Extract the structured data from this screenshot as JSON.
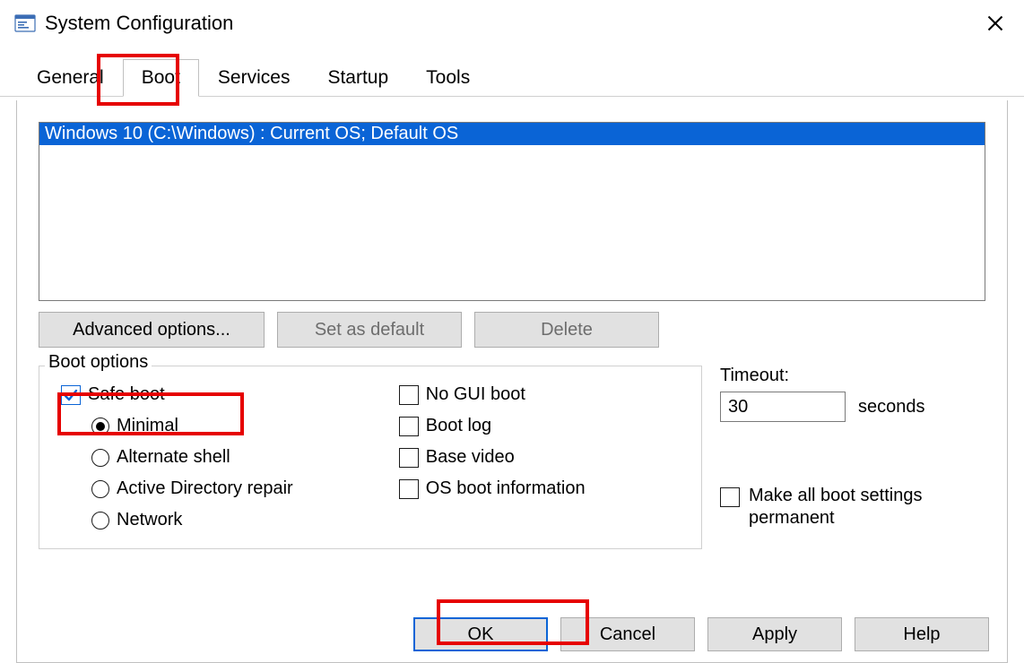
{
  "window": {
    "title": "System Configuration"
  },
  "tabs": {
    "items": [
      {
        "label": "General"
      },
      {
        "label": "Boot"
      },
      {
        "label": "Services"
      },
      {
        "label": "Startup"
      },
      {
        "label": "Tools"
      }
    ],
    "active_index": 1
  },
  "os_list": {
    "items": [
      "Windows 10 (C:\\Windows) : Current OS; Default OS"
    ],
    "selected_index": 0
  },
  "buttons": {
    "advanced": "Advanced options...",
    "set_default": "Set as default",
    "delete": "Delete"
  },
  "boot_options": {
    "legend": "Boot options",
    "safe_boot": {
      "label": "Safe boot",
      "checked": true
    },
    "safe_modes": {
      "minimal": {
        "label": "Minimal",
        "selected": true
      },
      "altshell": {
        "label": "Alternate shell",
        "selected": false
      },
      "adrepair": {
        "label": "Active Directory repair",
        "selected": false
      },
      "network": {
        "label": "Network",
        "selected": false
      }
    },
    "no_gui": {
      "label": "No GUI boot",
      "checked": false
    },
    "boot_log": {
      "label": "Boot log",
      "checked": false
    },
    "base_video": {
      "label": "Base video",
      "checked": false
    },
    "os_info": {
      "label": "OS boot information",
      "checked": false
    }
  },
  "timeout": {
    "label": "Timeout:",
    "value": "30",
    "unit": "seconds"
  },
  "permanent": {
    "label": "Make all boot settings permanent",
    "checked": false
  },
  "footer": {
    "ok": "OK",
    "cancel": "Cancel",
    "apply": "Apply",
    "help": "Help"
  },
  "highlighted_elements": [
    "tab-boot",
    "safe-boot-checkbox",
    "ok-button"
  ]
}
